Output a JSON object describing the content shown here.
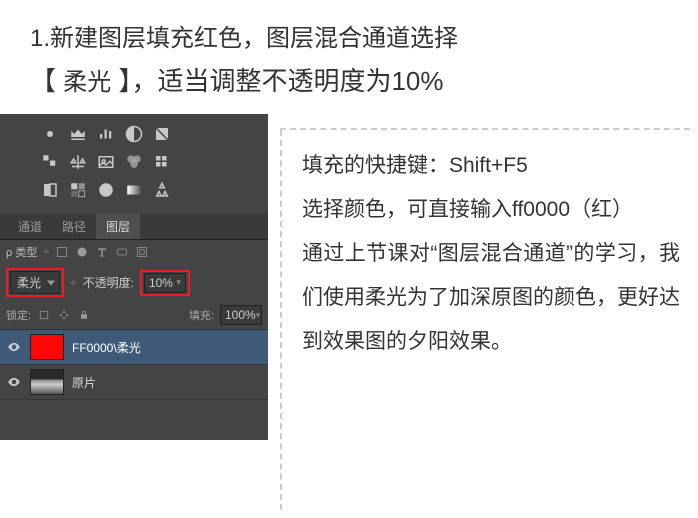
{
  "header": {
    "line1": "1.新建图层填充红色，图层混合通道选择",
    "line2_pre": "【 ",
    "line2_mode": "柔光",
    "line2_post": " 】，适当调整不透明度为10%"
  },
  "panel": {
    "tabs": {
      "t1": "通道",
      "t2": "路径",
      "t3": "图层"
    },
    "kind_label": "ρ 类型",
    "blend_mode": "柔光",
    "opacity_label": "不透明度:",
    "opacity_value": "10%",
    "lock_label": "锁定:",
    "fill_label": "填充:",
    "fill_value": "100%",
    "layer1_name": "FF0000\\柔光",
    "layer2_name": "原片"
  },
  "notes": {
    "p1": "填充的快捷键：Shift+F5",
    "p2": "选择颜色，可直接输入ff0000（红）",
    "p3": "通过上节课对“图层混合通道”的学习，我们使用柔光为了加深原图的颜色，更好达到效果图的夕阳效果。"
  }
}
